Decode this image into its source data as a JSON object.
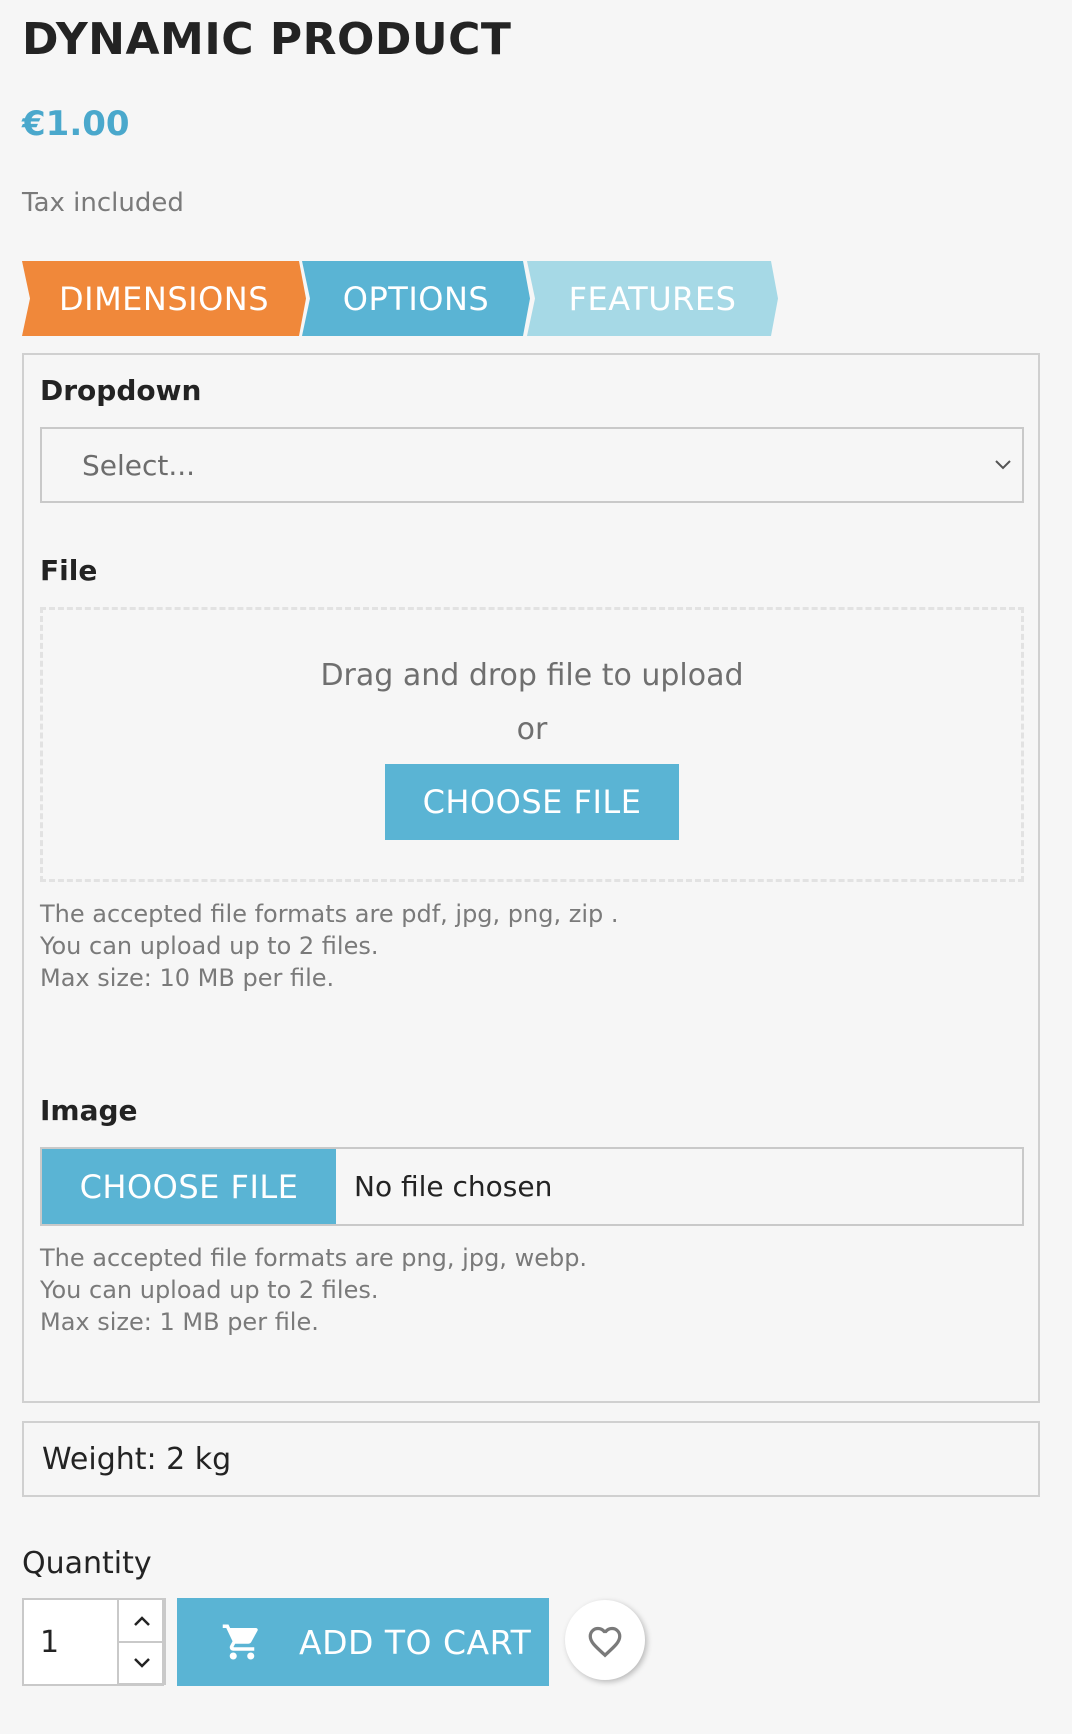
{
  "product": {
    "title": "DYNAMIC PRODUCT",
    "price": "€1.00",
    "tax_note": "Tax included"
  },
  "steps": [
    {
      "label": "DIMENSIONS",
      "color": "#f0883a",
      "state": "active"
    },
    {
      "label": "OPTIONS",
      "color": "#5ab4d4",
      "state": "default"
    },
    {
      "label": "FEATURES",
      "color": "#a6d9e6",
      "state": "default"
    }
  ],
  "form": {
    "dropdown": {
      "label": "Dropdown",
      "selected": "Select...",
      "icon": "chevron-down-icon"
    },
    "file": {
      "label": "File",
      "dropzone_text": "Drag and drop file to upload",
      "or_text": "or",
      "button_label": "CHOOSE FILE",
      "help": [
        "The accepted file formats are pdf, jpg, png, zip .",
        "You can upload up to 2 files.",
        "Max size: 10 MB per file."
      ]
    },
    "image": {
      "label": "Image",
      "button_label": "CHOOSE FILE",
      "status": "No file chosen",
      "help": [
        "The accepted file formats are png, jpg, webp.",
        "You can upload up to 2 files.",
        "Max size: 1 MB per file."
      ]
    }
  },
  "weight": "Weight: 2 kg",
  "cart": {
    "quantity_label": "Quantity",
    "quantity_value": "1",
    "add_to_cart_label": "ADD TO CART",
    "cart_icon": "shopping-cart-icon",
    "wishlist_icon": "heart-icon"
  },
  "colors": {
    "accent": "#5ab4d4",
    "price": "#4aa8cc",
    "step_active": "#f0883a"
  }
}
